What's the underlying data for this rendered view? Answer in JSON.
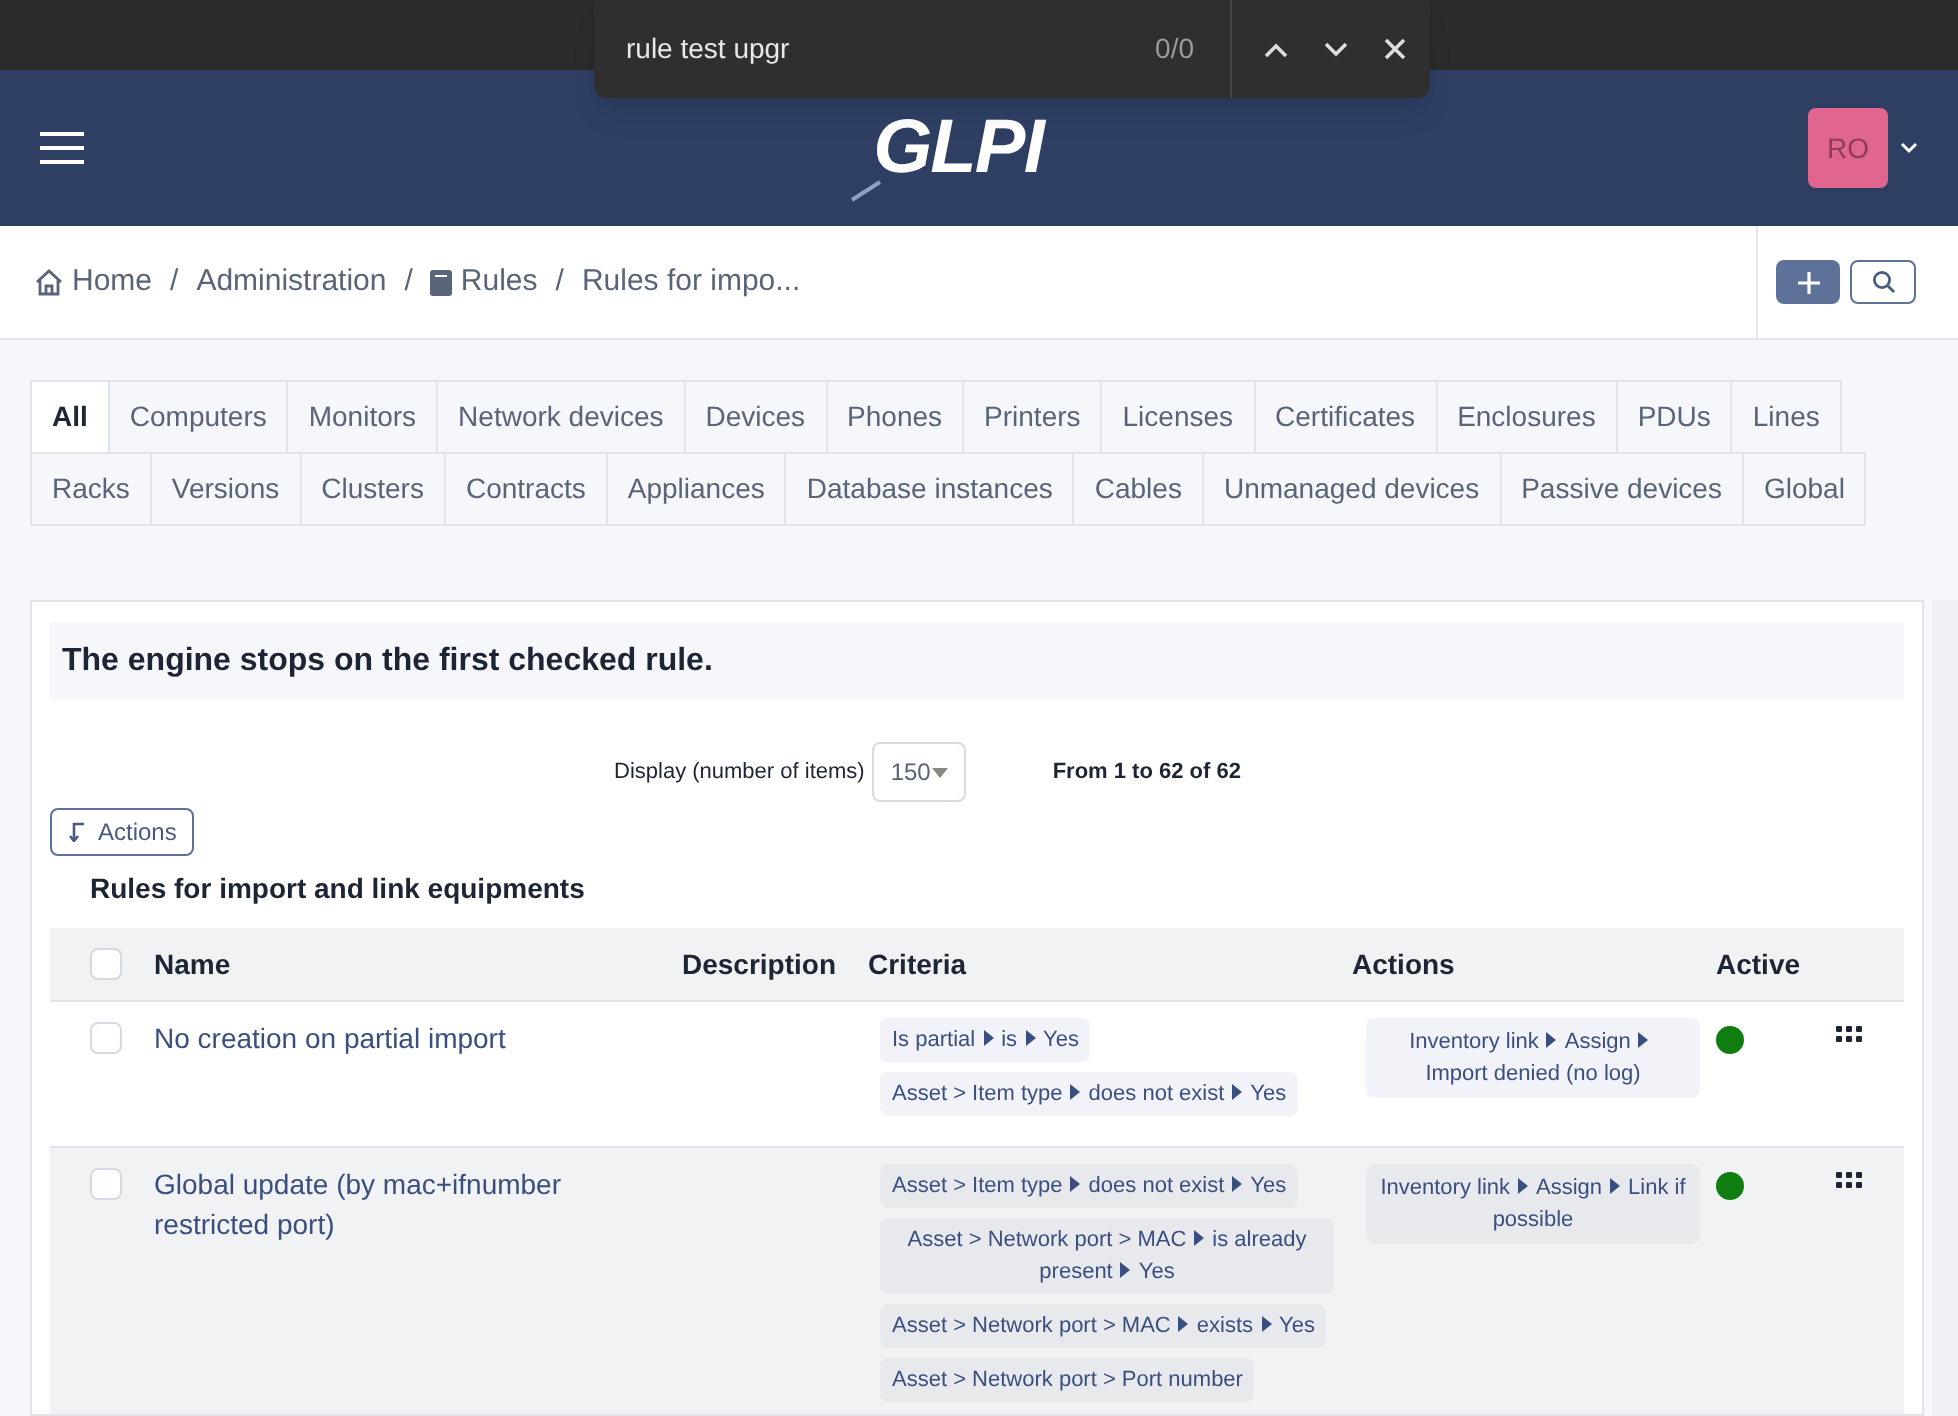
{
  "find_bar": {
    "query": "rule test upgr",
    "count": "0/0"
  },
  "header": {
    "logo": "GLPI",
    "avatar": "RO"
  },
  "breadcrumb": [
    {
      "label": "Home"
    },
    {
      "separator": "/",
      "label": "Administration"
    },
    {
      "separator": "/",
      "label": "Rules"
    },
    {
      "separator": "/",
      "label": "Rules for impo..."
    }
  ],
  "tabs": [
    {
      "label": "All",
      "selected": true
    },
    {
      "label": "Computers",
      "selected": false
    },
    {
      "label": "Monitors",
      "selected": false
    },
    {
      "label": "Network devices",
      "selected": false
    },
    {
      "label": "Devices",
      "selected": false
    },
    {
      "label": "Phones",
      "selected": false
    },
    {
      "label": "Printers",
      "selected": false
    },
    {
      "label": "Licenses",
      "selected": false
    },
    {
      "label": "Certificates",
      "selected": false
    },
    {
      "label": "Enclosures",
      "selected": false
    },
    {
      "label": "PDUs",
      "selected": false
    },
    {
      "label": "Lines",
      "selected": false
    },
    {
      "label": "Racks",
      "selected": false
    },
    {
      "label": "Versions",
      "selected": false
    },
    {
      "label": "Clusters",
      "selected": false
    },
    {
      "label": "Contracts",
      "selected": false
    },
    {
      "label": "Appliances",
      "selected": false
    },
    {
      "label": "Database instances",
      "selected": false
    },
    {
      "label": "Cables",
      "selected": false
    },
    {
      "label": "Unmanaged devices",
      "selected": false
    },
    {
      "label": "Passive devices",
      "selected": false
    },
    {
      "label": "Global",
      "selected": false
    }
  ],
  "notice": "The engine stops on the first checked rule.",
  "pager": {
    "label": "Display (number of items)",
    "value": "150",
    "range": "From 1 to 62 of 62"
  },
  "actions_button": "Actions",
  "table": {
    "title": "Rules for import and link equipments",
    "select_all_checked": false,
    "columns": [
      "Name",
      "Description",
      "Criteria",
      "Actions",
      "Active"
    ],
    "rows": [
      {
        "checked": false,
        "name": "No creation on partial import",
        "criteria": [
          [
            "Is partial",
            "is",
            "Yes"
          ],
          [
            "Asset > Item type",
            "does not exist",
            "Yes"
          ]
        ],
        "actions": [
          [
            "Inventory link",
            "Assign",
            "Import denied (no log)"
          ]
        ],
        "active": true
      },
      {
        "checked": false,
        "name": "Global update (by mac+ifnumber restricted port)",
        "criteria": [
          [
            "Asset > Item type",
            "does not exist",
            "Yes"
          ],
          [
            "Asset > Network port > MAC",
            "is already present",
            "Yes"
          ],
          [
            "Asset > Network port > MAC",
            "exists",
            "Yes"
          ],
          [
            "Asset > Network port > Port number"
          ]
        ],
        "actions": [
          [
            "Inventory link",
            "Assign",
            "Link if possible"
          ]
        ],
        "active": true
      }
    ]
  }
}
